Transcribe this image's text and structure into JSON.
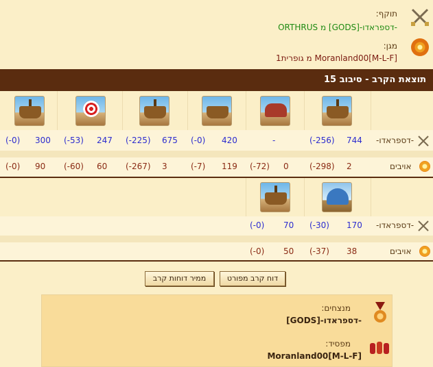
{
  "attacker": {
    "label": "תוקף:",
    "value": "-דספראדו-[GODS] מ ORTHRUS"
  },
  "defender": {
    "label": "מגן:",
    "value": "Moranland00[M-L-F] מ גופרית1"
  },
  "result_bar": "תוצאת הקרב - סיבוב 15",
  "rows1": {
    "attacker_name": "-דספראדו-",
    "attacker_values": [
      {
        "v": "744",
        "d": "(-256)"
      },
      {
        "v": "-",
        "d": ""
      },
      {
        "v": "420",
        "d": "(-0)"
      },
      {
        "v": "675",
        "d": "(-225)"
      },
      {
        "v": "247",
        "d": "(-53)"
      },
      {
        "v": "300",
        "d": "(-0)"
      }
    ],
    "enemy_name": "אויבים",
    "enemy_values": [
      {
        "v": "2",
        "d": "(-298)"
      },
      {
        "v": "0",
        "d": "(-72)"
      },
      {
        "v": "119",
        "d": "(-7)"
      },
      {
        "v": "3",
        "d": "(-267)"
      },
      {
        "v": "60",
        "d": "(-60)"
      },
      {
        "v": "90",
        "d": "(-0)"
      }
    ]
  },
  "rows2": {
    "attacker_name": "-דספראדו-",
    "attacker_values": [
      {
        "v": "170",
        "d": "(-30)"
      },
      {
        "v": "70",
        "d": "(-0)"
      }
    ],
    "enemy_name": "אויבים",
    "enemy_values": [
      {
        "v": "38",
        "d": "(-37)"
      },
      {
        "v": "50",
        "d": "(-0)"
      }
    ]
  },
  "buttons": {
    "detailed": "דוח קרב מפורט",
    "convert": "ממיר דוחות קרב"
  },
  "summary": {
    "winners_label": "מנצחים:",
    "winners_value": "-דספראדו-[GODS]",
    "loser_label": "מפסיד:",
    "loser_value": "Moranland00[M-L-F]"
  },
  "icons": {
    "attacker": "crossed-swords-icon",
    "defender": "shield-icon",
    "winner": "medal-icon",
    "loser": "troops-icon"
  }
}
